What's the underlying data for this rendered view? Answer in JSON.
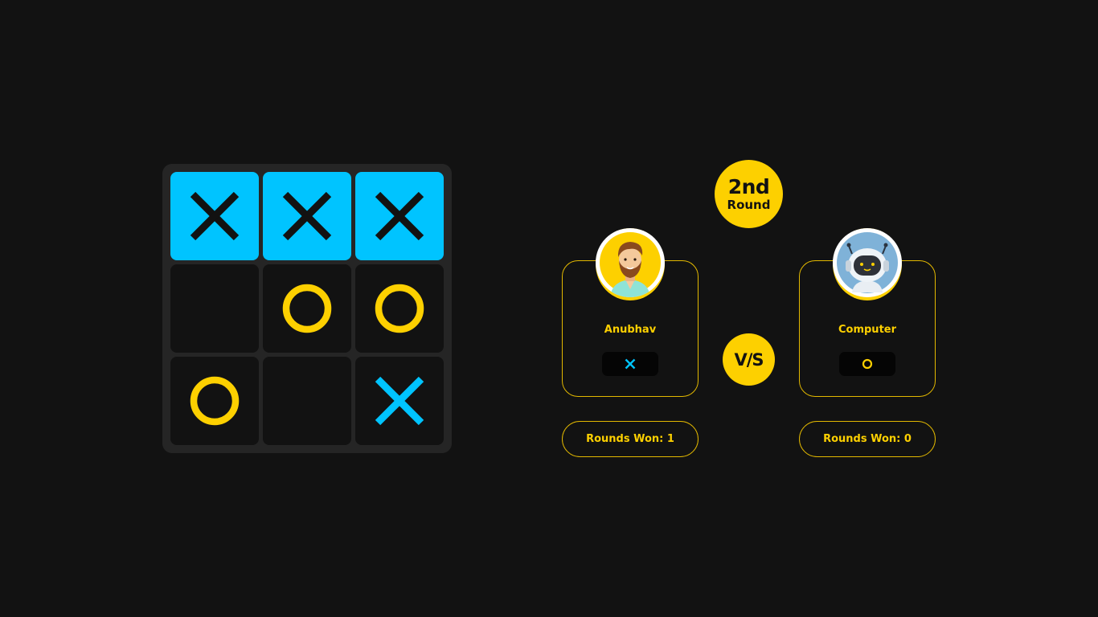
{
  "colors": {
    "background": "#121212",
    "board": "#252525",
    "cell": "#121212",
    "winning_cell": "#00c4ff",
    "accent_yellow": "#fdd000",
    "x_blue": "#00c4ff",
    "mark_on_win": "#121212"
  },
  "board": {
    "cells": [
      {
        "mark": "X",
        "winning": true
      },
      {
        "mark": "X",
        "winning": true
      },
      {
        "mark": "X",
        "winning": true
      },
      {
        "mark": "",
        "winning": false
      },
      {
        "mark": "O",
        "winning": false
      },
      {
        "mark": "O",
        "winning": false
      },
      {
        "mark": "O",
        "winning": false
      },
      {
        "mark": "",
        "winning": false
      },
      {
        "mark": "X",
        "winning": false
      }
    ]
  },
  "round": {
    "ordinal": "2nd",
    "word": "Round"
  },
  "vs_label": "V/S",
  "players": [
    {
      "name": "Anubhav",
      "avatar": "bearded-man-avatar",
      "symbol": "X",
      "rounds_won_label": "Rounds Won: 1"
    },
    {
      "name": "Computer",
      "avatar": "robot-avatar",
      "symbol": "O",
      "rounds_won_label": "Rounds Won: 0"
    }
  ]
}
